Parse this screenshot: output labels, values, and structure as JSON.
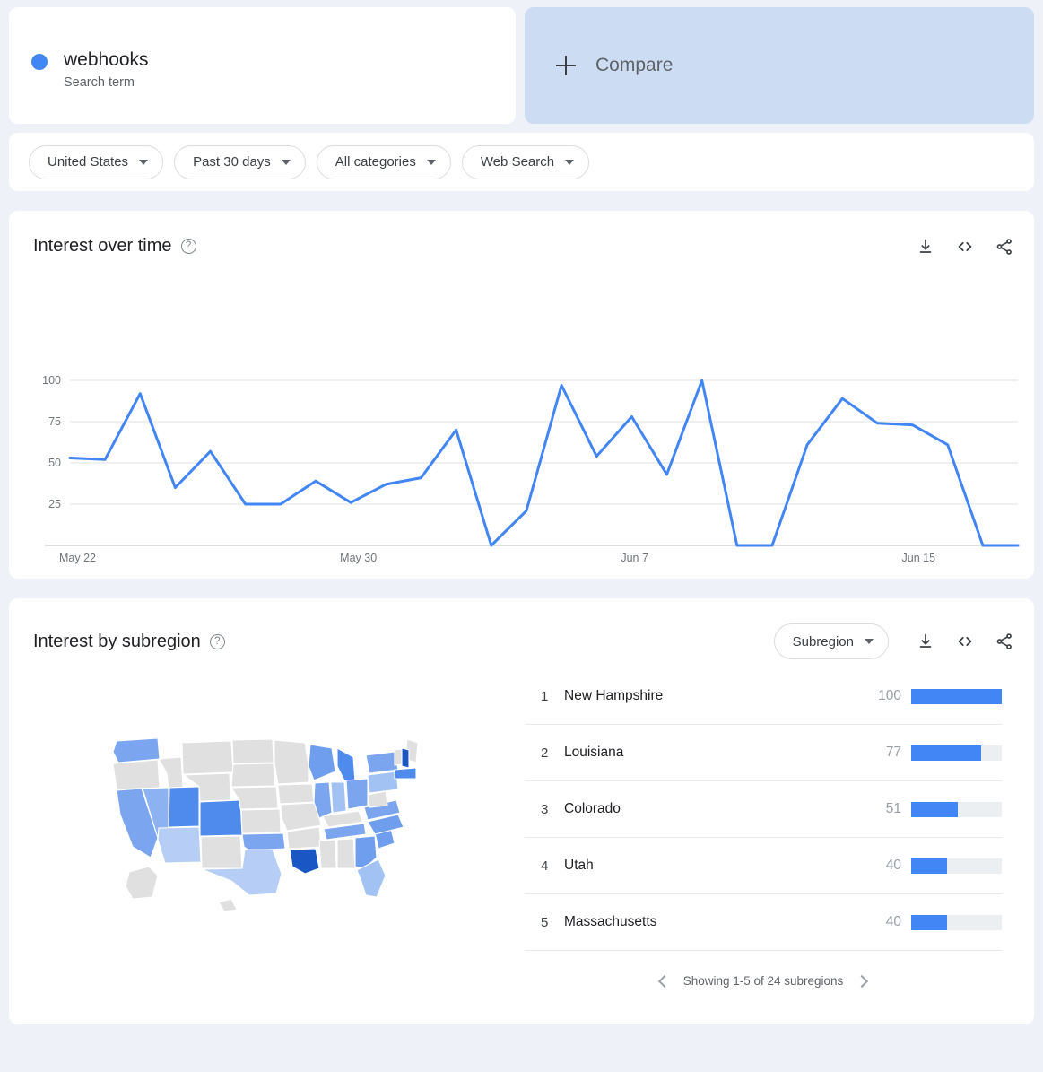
{
  "query": {
    "term": "webhooks",
    "type_label": "Search term",
    "dot_color": "#4285f4",
    "compare_label": "Compare"
  },
  "filters": [
    {
      "label": "United States",
      "name": "filter-location"
    },
    {
      "label": "Past 30 days",
      "name": "filter-time"
    },
    {
      "label": "All categories",
      "name": "filter-category"
    },
    {
      "label": "Web Search",
      "name": "filter-search-type"
    }
  ],
  "interest_over_time": {
    "title": "Interest over time",
    "help": "?",
    "actions": [
      "download-icon",
      "embed-icon",
      "share-icon"
    ]
  },
  "interest_by_subregion": {
    "title": "Interest by subregion",
    "help": "?",
    "select_label": "Subregion",
    "actions": [
      "download-icon",
      "embed-icon",
      "share-icon"
    ],
    "rows": [
      {
        "rank": "1",
        "name": "New Hampshire",
        "value": 100
      },
      {
        "rank": "2",
        "name": "Louisiana",
        "value": 77
      },
      {
        "rank": "3",
        "name": "Colorado",
        "value": 51
      },
      {
        "rank": "4",
        "name": "Utah",
        "value": 40
      },
      {
        "rank": "5",
        "name": "Massachusetts",
        "value": 40
      }
    ],
    "pager_text": "Showing 1-5 of 24 subregions",
    "map_max_color": "#1a56c4",
    "map_empty_color": "#e0e0e0"
  },
  "chart_data": {
    "type": "line",
    "title": "Interest over time",
    "xlabel": "",
    "ylabel": "",
    "ylim": [
      0,
      100
    ],
    "yticks": [
      25,
      50,
      75,
      100
    ],
    "grid": true,
    "legend": "none",
    "line_color": "#4285f4",
    "x": [
      "May 22",
      "May 23",
      "May 24",
      "May 25",
      "May 26",
      "May 27",
      "May 28",
      "May 29",
      "May 30",
      "May 31",
      "Jun 1",
      "Jun 2",
      "Jun 3",
      "Jun 4",
      "Jun 5",
      "Jun 6",
      "Jun 7",
      "Jun 8",
      "Jun 9",
      "Jun 10",
      "Jun 11",
      "Jun 12",
      "Jun 13",
      "Jun 14",
      "Jun 15",
      "Jun 16",
      "Jun 17",
      "Jun 18"
    ],
    "xtick_labels": [
      "May 22",
      "May 30",
      "Jun 7",
      "Jun 15"
    ],
    "xtick_indices": [
      0,
      8,
      16,
      24
    ],
    "series": [
      {
        "name": "webhooks",
        "values": [
          53,
          52,
          92,
          35,
          57,
          25,
          25,
          39,
          26,
          37,
          41,
          70,
          0,
          21,
          97,
          54,
          78,
          43,
          100,
          0,
          0,
          61,
          89,
          74,
          73,
          61,
          0,
          0
        ]
      }
    ]
  }
}
